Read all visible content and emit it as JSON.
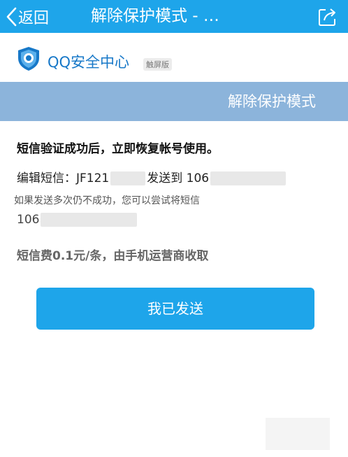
{
  "header": {
    "back_label": "返回",
    "title": "解除保护模式 - …"
  },
  "brand": {
    "name": "QQ安全中心",
    "badge": "触屏版"
  },
  "section": {
    "title": "解除保护模式"
  },
  "content": {
    "headline": "短信验证成功后，立即恢复帐号使用。",
    "sms_prefix": "编辑短信：",
    "sms_code": "JF121",
    "sms_send_to": "发送到",
    "sms_number": "106",
    "hint": "如果发送多次仍不成功，您可以尝试将短信",
    "alt_number": "106",
    "fee": "短信费0.1元/条，由手机运营商收取"
  },
  "actions": {
    "sent_button": "我已发送"
  },
  "colors": {
    "primary": "#1ea5ea",
    "section_bar": "#8cb4db",
    "brand_text": "#1778c8"
  }
}
